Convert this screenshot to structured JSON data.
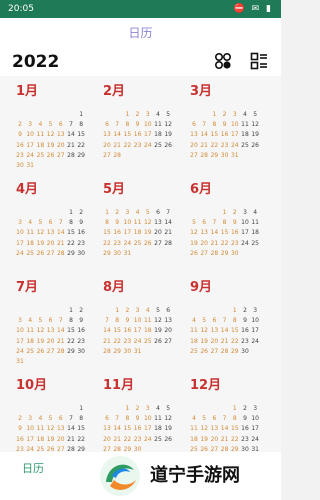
{
  "status": {
    "time": "20:05",
    "icons_text": "⛔ ✉ ▮"
  },
  "appbar": {
    "title": "日历"
  },
  "header": {
    "year": "2022",
    "icons": [
      "month-view-icon",
      "list-view-icon"
    ]
  },
  "months": [
    {
      "name": "1月",
      "start": 6,
      "days": 31
    },
    {
      "name": "2月",
      "start": 2,
      "days": 28
    },
    {
      "name": "3月",
      "start": 2,
      "days": 31
    },
    {
      "name": "4月",
      "start": 5,
      "days": 30
    },
    {
      "name": "5月",
      "start": 0,
      "days": 31
    },
    {
      "name": "6月",
      "start": 3,
      "days": 30
    },
    {
      "name": "7月",
      "start": 5,
      "days": 31
    },
    {
      "name": "8月",
      "start": 1,
      "days": 31
    },
    {
      "name": "9月",
      "start": 4,
      "days": 30
    },
    {
      "name": "10月",
      "start": 6,
      "days": 31
    },
    {
      "name": "11月",
      "start": 2,
      "days": 30
    },
    {
      "name": "12月",
      "start": 4,
      "days": 31
    }
  ],
  "bottom_nav": {
    "label": "日历"
  },
  "watermark": {
    "text": "道宁手游网"
  },
  "colors": {
    "accent": "#c8312f",
    "weekday": "#d28a36",
    "weekend": "#444444",
    "nav": "#2d9a6f"
  }
}
